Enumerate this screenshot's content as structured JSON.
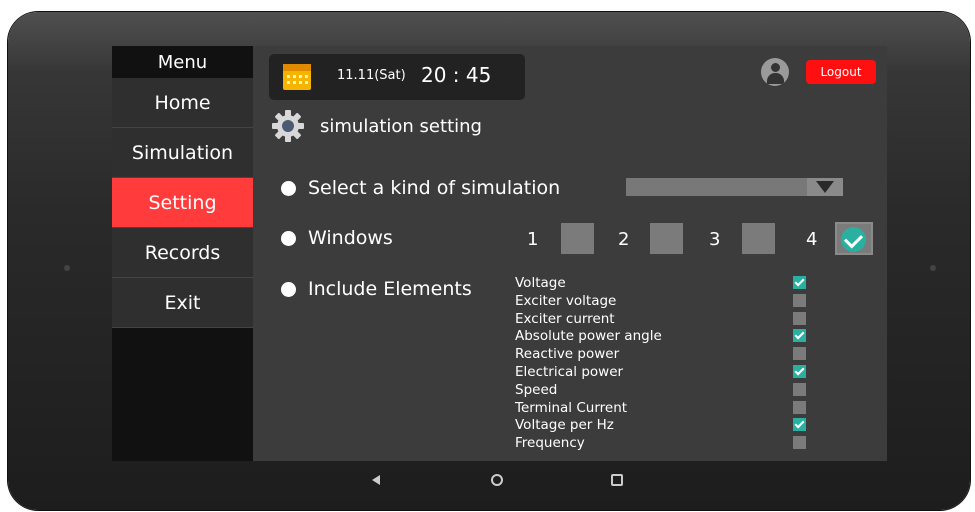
{
  "sidebar": {
    "title": "Menu",
    "items": [
      {
        "label": "Home"
      },
      {
        "label": "Simulation"
      },
      {
        "label": "Setting"
      },
      {
        "label": "Records"
      },
      {
        "label": "Exit"
      }
    ],
    "active": "Setting"
  },
  "header": {
    "date": "11.11(Sat)",
    "time": "20 : 45",
    "logout_label": "Logout"
  },
  "page": {
    "title": "simulation setting"
  },
  "settings": {
    "simulation_kind_label": "Select a kind of simulation",
    "simulation_kind_value": "",
    "windows_label": "Windows",
    "windows": [
      {
        "num": "1",
        "checked": false
      },
      {
        "num": "2",
        "checked": false
      },
      {
        "num": "3",
        "checked": false
      },
      {
        "num": "4",
        "checked": true
      }
    ],
    "include_elements_label": "Include Elements",
    "elements": [
      {
        "label": "Voltage",
        "checked": true
      },
      {
        "label": "Exciter voltage",
        "checked": false
      },
      {
        "label": "Exciter current",
        "checked": false
      },
      {
        "label": "Absolute power angle",
        "checked": true
      },
      {
        "label": "Reactive power",
        "checked": false
      },
      {
        "label": "Electrical power",
        "checked": true
      },
      {
        "label": "Speed",
        "checked": false
      },
      {
        "label": "Terminal Current",
        "checked": false
      },
      {
        "label": "Voltage per Hz",
        "checked": true
      },
      {
        "label": "Frequency",
        "checked": false
      }
    ]
  },
  "colors": {
    "accent": "#ff3b3b",
    "logout": "#ff1010",
    "check": "#2ab0a0",
    "panel": "#3c3c3c",
    "sidebar": "#111111"
  },
  "icons": {
    "calendar": "calendar-icon",
    "gear": "gear-icon",
    "user": "user-avatar-icon"
  }
}
